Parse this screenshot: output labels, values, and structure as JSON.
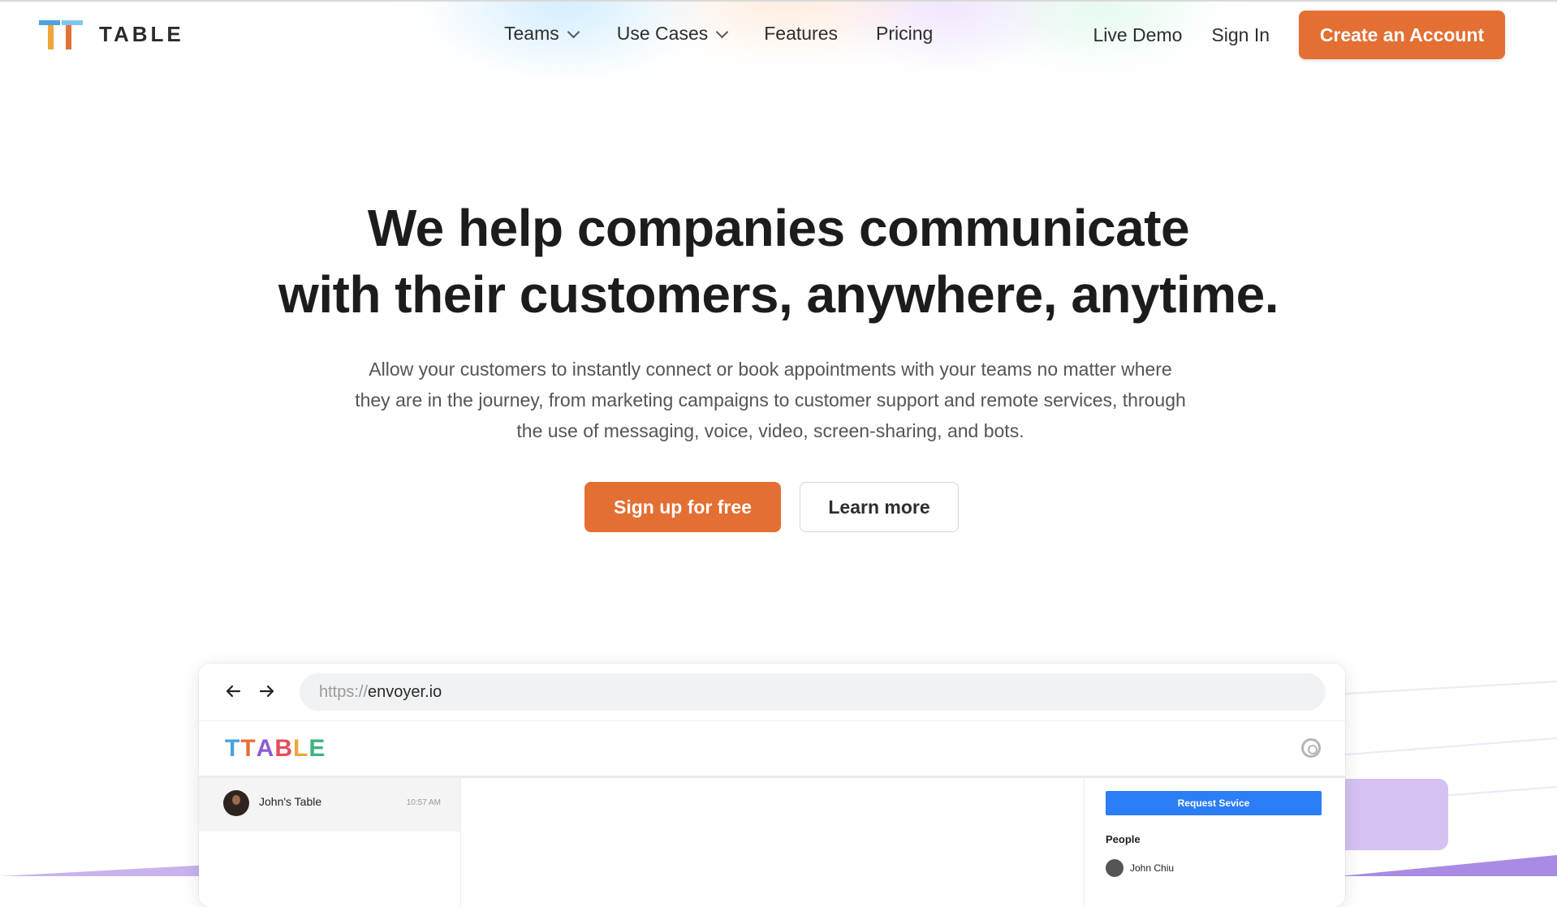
{
  "header": {
    "logo_text": "TABLE",
    "nav": {
      "teams": "Teams",
      "use_cases": "Use Cases",
      "features": "Features",
      "pricing": "Pricing"
    },
    "live_demo": "Live Demo",
    "sign_in": "Sign In",
    "create_account": "Create an Account"
  },
  "hero": {
    "title_line1": "We help companies communicate",
    "title_line2": "with their customers, anywhere, anytime.",
    "subtitle_line1": "Allow your customers to instantly connect or book appointments with your teams no matter where",
    "subtitle_line2": "they are in the journey, from marketing campaigns to customer support and remote services, through",
    "subtitle_line3": "the use of messaging, voice, video, screen-sharing, and bots.",
    "signup_label": "Sign up for free",
    "learn_more_label": "Learn more"
  },
  "mockup": {
    "url_protocol": "https://",
    "url_host": "envoyer.io",
    "app_logo": "TABLE",
    "chat_name": "John's Table",
    "chat_time": "10:57 AM",
    "request_button": "Request Sevice",
    "people_heading": "People",
    "person_name": "John Chiu"
  },
  "colors": {
    "accent": "#e46f33",
    "request_blue": "#2b7ef6",
    "deco_purple": "#d5c2f2"
  },
  "icons": [
    "chevron-down-icon",
    "back-arrow-icon",
    "forward-arrow-icon",
    "gear-icon"
  ]
}
